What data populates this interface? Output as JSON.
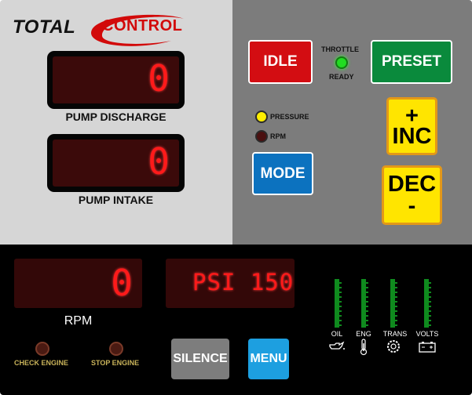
{
  "logo": {
    "total": "TOTAL",
    "control": "CONTROL"
  },
  "displays": {
    "pump_discharge": {
      "value": "0",
      "label": "PUMP DISCHARGE"
    },
    "pump_intake": {
      "value": "0",
      "label": "PUMP INTAKE"
    },
    "rpm": {
      "value": "0",
      "label": "RPM"
    },
    "preset": {
      "value": "PSI 150"
    }
  },
  "buttons": {
    "idle": "IDLE",
    "preset": "PRESET",
    "mode": "MODE",
    "inc_symbol": "+",
    "inc": "INC",
    "dec": "DEC",
    "dec_symbol": "-",
    "silence": "SILENCE",
    "menu": "MENU"
  },
  "indicators": {
    "throttle_line1": "THROTTLE",
    "throttle_line2": "READY",
    "pressure": "PRESSURE",
    "rpm": "RPM",
    "check_engine": "CHECK ENGINE",
    "stop_engine": "STOP ENGINE"
  },
  "gauges": [
    {
      "label": "OIL",
      "icon": "oil-can-icon"
    },
    {
      "label": "ENG",
      "icon": "thermometer-icon"
    },
    {
      "label": "TRANS",
      "icon": "gear-icon"
    },
    {
      "label": "VOLTS",
      "icon": "battery-icon"
    }
  ],
  "colors": {
    "led_red": "#ff1a1a",
    "idle": "#d30d12",
    "preset": "#0a8a3c",
    "mode": "#0c72bf",
    "inc_dec": "#ffe500",
    "silence": "#7d7d7d",
    "menu": "#1d9fe0",
    "throttle_ready_led": "#22dd22",
    "pressure_led": "#ffee00"
  }
}
